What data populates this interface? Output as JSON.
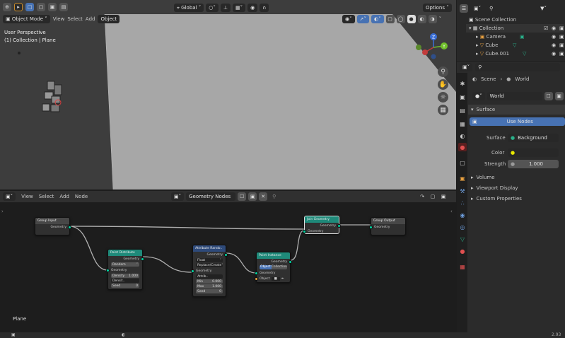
{
  "viewport": {
    "mode_label": "Object Mode",
    "menu": [
      "View",
      "Select",
      "Add",
      "Object"
    ],
    "transform_orientation": "Global",
    "options_label": "Options",
    "perspective": "User Perspective",
    "context": "(1) Collection | Plane",
    "axes": {
      "z": "Z",
      "y": "Y"
    }
  },
  "outliner": {
    "scene_collection": "Scene Collection",
    "items": [
      {
        "label": "Collection"
      },
      {
        "label": "Camera"
      },
      {
        "label": "Cube"
      },
      {
        "label": "Cube.001"
      }
    ]
  },
  "properties": {
    "scene_tab": "Scene",
    "world_tab": "World",
    "world_name": "World",
    "surface_section": "Surface",
    "use_nodes_label": "Use Nodes",
    "surface_label": "Surface",
    "surface_value": "Background",
    "color_label": "Color",
    "color_value": "#e8e800",
    "strength_label": "Strength",
    "strength_value": "1.000",
    "sections": [
      "Volume",
      "Viewport Display",
      "Custom Properties"
    ]
  },
  "node_editor": {
    "menu": [
      "View",
      "Select",
      "Add",
      "Node"
    ],
    "tree_name": "Geometry Nodes",
    "object_label": "Plane",
    "nodes": {
      "group_input": {
        "title": "Group Input",
        "out": "Geometry"
      },
      "group_output": {
        "title": "Group Output",
        "in": "Geometry"
      },
      "point_distribute": {
        "title": "Point Distribute",
        "out": "Geometry",
        "mode": "Random",
        "in": "Geometry",
        "density_label": "Density",
        "density_value": "1.000",
        "density2_label": "Densit..",
        "seed_label": "Seed",
        "seed_value": "0"
      },
      "attribute_random": {
        "title": "Attribute Rando..",
        "out": "Geometry",
        "type": "Float",
        "op": "Replace/Create",
        "in": "Geometry",
        "attr_label": "Attrib..",
        "min_label": "Min",
        "min_value": "0.000",
        "max_label": "Max",
        "max_value": "1.000",
        "seed_label": "Seed",
        "seed_value": "0"
      },
      "point_instance": {
        "title": "Point Instance",
        "out": "Geometry",
        "tab_object": "Object",
        "tab_collection": "Collection",
        "in": "Geometry",
        "obj_label": "Object"
      },
      "join_geometry": {
        "title": "Join Geometry",
        "out": "Geometry",
        "in": "Geometry"
      }
    }
  },
  "status": {
    "version": "2.93"
  }
}
